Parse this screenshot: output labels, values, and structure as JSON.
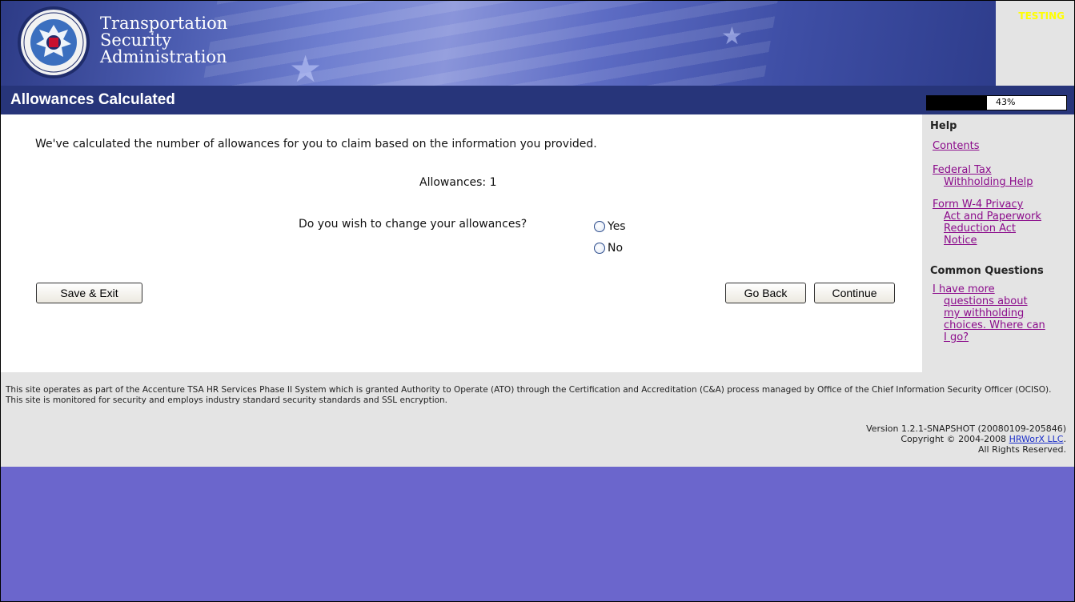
{
  "header": {
    "agency_line1": "Transportation",
    "agency_line2": "Security",
    "agency_line3": "Administration",
    "testing_label": "TESTING"
  },
  "titlebar": {
    "title": "Allowances Calculated",
    "progress_label": "43%",
    "progress_value": 43
  },
  "main": {
    "intro": "We've calculated the number of allowances for you to claim based on the information you provided.",
    "allowances": "Allowances: 1",
    "question": "Do you wish to change your allowances?",
    "option_yes": "Yes",
    "option_no": "No",
    "save_exit_label": "Save & Exit",
    "go_back_label": "Go Back",
    "continue_label": "Continue"
  },
  "help": {
    "heading": "Help",
    "contents": "Contents",
    "federal_tax_1": "Federal Tax",
    "federal_tax_2": "Withholding Help",
    "w4_1": "Form W-4 Privacy",
    "w4_2": "Act and Paperwork",
    "w4_3": "Reduction Act",
    "w4_4": "Notice",
    "common_heading": "Common Questions",
    "q_1": "I have more",
    "q_2": "questions about",
    "q_3": "my withholding",
    "q_4": "choices. Where can",
    "q_5": "I go?"
  },
  "footer": {
    "notice": "This site operates as part of the Accenture TSA HR Services Phase II System which is granted Authority to Operate (ATO) through the Certification and Accreditation (C&A) process managed by Office of the Chief Information Security Officer (OCISO). This site is monitored for security and employs industry standard security standards and SSL encryption.",
    "version": "Version 1.2.1-SNAPSHOT (20080109-205846)",
    "copyright_prefix": "Copyright © 2004-2008 ",
    "copyright_link": "HRWorX LLC",
    "copyright_suffix": ".",
    "rights": "All Rights Reserved."
  },
  "colors": {
    "background": "#6b66cc",
    "titlebar": "#27357a",
    "help_link": "#8b0b8b",
    "testing": "#ffff00"
  },
  "icons": {
    "seal": "dhs-seal-icon",
    "radio": "radio-icon"
  }
}
